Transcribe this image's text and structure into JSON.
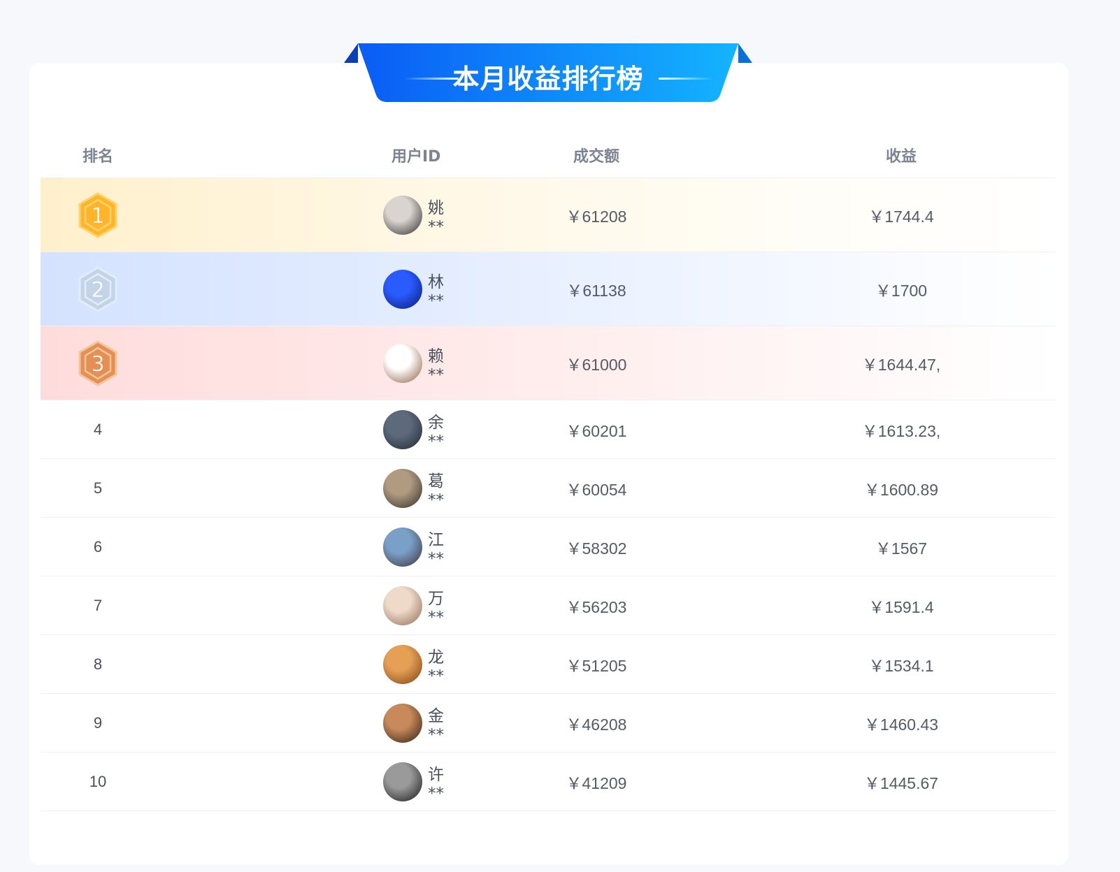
{
  "header": {
    "title": "本月收益排行榜"
  },
  "table": {
    "columns": {
      "rank": "排名",
      "user": "用户ID",
      "amount": "成交额",
      "income": "收益"
    },
    "rows": [
      {
        "rank": "1",
        "name": "姚**",
        "amount": "￥61208",
        "income": "￥1744.4",
        "avatar": "panda-avatar",
        "c1": "#d9d4cf",
        "c2": "#2a2a2a"
      },
      {
        "rank": "2",
        "name": "林**",
        "amount": "￥61138",
        "income": "￥1700",
        "avatar": "tech-avatar",
        "c1": "#2a5bff",
        "c2": "#0b1a6e"
      },
      {
        "rank": "3",
        "name": "赖**",
        "amount": "￥61000",
        "income": "￥1644.47,",
        "avatar": "cartoon-boy-avatar",
        "c1": "#ffffff",
        "c2": "#8a5a3a"
      },
      {
        "rank": "4",
        "name": "余**",
        "amount": "￥60201",
        "income": "￥1613.23,",
        "avatar": "dark-portrait-avatar",
        "c1": "#5d6a7c",
        "c2": "#1f2630"
      },
      {
        "rank": "5",
        "name": "葛**",
        "amount": "￥60054",
        "income": "￥1600.89",
        "avatar": "car-avatar",
        "c1": "#b09a80",
        "c2": "#2f2a26"
      },
      {
        "rank": "6",
        "name": "江**",
        "amount": "￥58302",
        "income": "￥1567",
        "avatar": "person-city-avatar",
        "c1": "#7aa0c8",
        "c2": "#3c2f3a"
      },
      {
        "rank": "7",
        "name": "万**",
        "amount": "￥56203",
        "income": "￥1591.4",
        "avatar": "illustration-avatar",
        "c1": "#efd9c8",
        "c2": "#8c6a55"
      },
      {
        "rank": "8",
        "name": "龙**",
        "amount": "￥51205",
        "income": "￥1534.1",
        "avatar": "dog-avatar",
        "c1": "#e6a055",
        "c2": "#7a3f14"
      },
      {
        "rank": "9",
        "name": "金**",
        "amount": "￥46208",
        "income": "￥1460.43",
        "avatar": "warm-photo-avatar",
        "c1": "#c88a5a",
        "c2": "#2c1c14"
      },
      {
        "rank": "10",
        "name": "许**",
        "amount": "￥41209",
        "income": "￥1445.67",
        "avatar": "black-white-avatar",
        "c1": "#9a9a9a",
        "c2": "#141414"
      }
    ]
  },
  "medals": {
    "gold": {
      "fill": "#ffb52b",
      "stroke": "#ffd36b",
      "text": "#ffffff"
    },
    "silver": {
      "fill": "#c3d3e8",
      "stroke": "#e3ecf7",
      "text": "#ffffff"
    },
    "bronze": {
      "fill": "#e49055",
      "stroke": "#f6c49b",
      "text": "#ffffff"
    }
  }
}
